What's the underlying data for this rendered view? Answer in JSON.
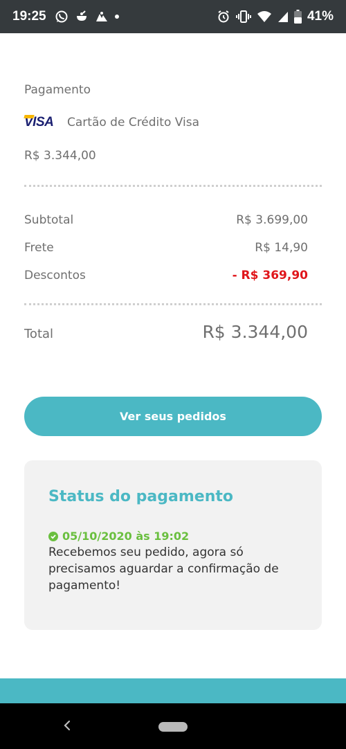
{
  "status_bar": {
    "time": "19:25",
    "battery_pct": "41%",
    "left_icons": [
      "whatsapp-icon",
      "notification-app-icon",
      "notification-app-icon-2",
      "more-dot-icon"
    ],
    "right_icons": [
      "alarm-icon",
      "vibrate-icon",
      "wifi-icon",
      "signal-icon",
      "battery-icon"
    ]
  },
  "payment": {
    "section_title": "Pagamento",
    "card_brand": "VISA",
    "card_label": "Cartão de Crédito Visa",
    "amount": "R$ 3.344,00"
  },
  "summary": {
    "rows": [
      {
        "label": "Subtotal",
        "value": "R$ 3.699,00"
      },
      {
        "label": "Frete",
        "value": "R$ 14,90"
      },
      {
        "label": "Descontos",
        "value": "- R$ 369,90"
      }
    ],
    "total_label": "Total",
    "total_value": "R$ 3.344,00"
  },
  "cta": {
    "label": "Ver seus pedidos"
  },
  "status": {
    "title": "Status do pagamento",
    "date": "05/10/2020 às 19:02",
    "message": "Recebemos seu pedido, agora só precisamos aguardar a confirmação de pagamento!"
  },
  "colors": {
    "accent": "#4bb8c4",
    "discount": "#e0161b",
    "success": "#6abf3f",
    "status_bar_bg": "#353a3d"
  }
}
